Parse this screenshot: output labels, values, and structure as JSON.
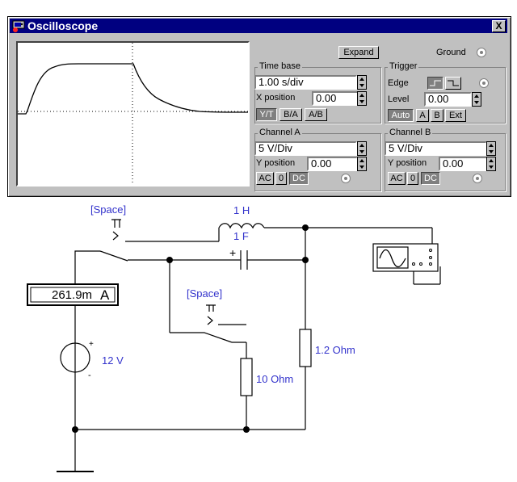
{
  "window": {
    "title": "Oscilloscope",
    "close_label": "X",
    "expand_label": "Expand",
    "ground_label": "Ground"
  },
  "timebase": {
    "group_label": "Time base",
    "value": "1.00 s/div",
    "xpos_label": "X position",
    "xpos_value": "0.00",
    "modes": [
      "Y/T",
      "B/A",
      "A/B"
    ]
  },
  "trigger": {
    "group_label": "Trigger",
    "edge_label": "Edge",
    "level_label": "Level",
    "level_value": "0.00",
    "sources": [
      "Auto",
      "A",
      "B",
      "Ext"
    ]
  },
  "channel_a": {
    "group_label": "Channel A",
    "value": "5 V/Div",
    "ypos_label": "Y position",
    "ypos_value": "0.00",
    "coupling": [
      "AC",
      "0",
      "DC"
    ]
  },
  "channel_b": {
    "group_label": "Channel B",
    "value": "5 V/Div",
    "ypos_label": "Y position",
    "ypos_value": "0.00",
    "coupling": [
      "AC",
      "0",
      "DC"
    ]
  },
  "circuit": {
    "switch1_label": "[Space]",
    "switch2_label": "[Space]",
    "inductor_label": "1 H",
    "capacitor_label": "1 F",
    "capacitor_polarity": "+",
    "ammeter_value": "261.9m",
    "ammeter_unit": "A",
    "source_label": "12 V",
    "source_plus": "+",
    "source_minus": "-",
    "resistor1_label": "10 Ohm",
    "resistor2_label": "1.2 Ohm"
  },
  "colors": {
    "title_bar": "#000080",
    "panel": "#c0c0c0",
    "label_blue": "#3333cc"
  }
}
